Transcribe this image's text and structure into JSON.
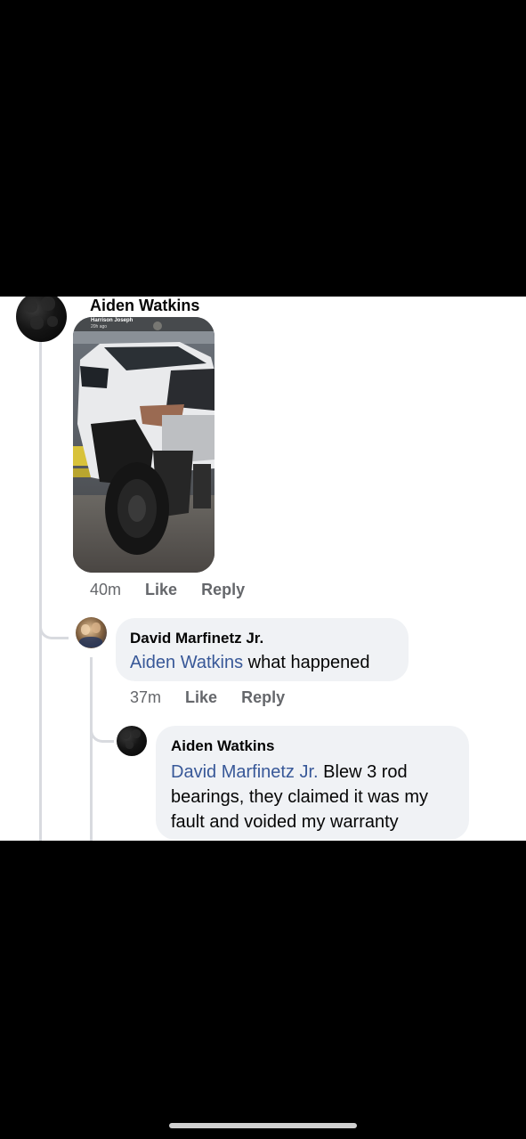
{
  "comment": {
    "author": "Aiden Watkins",
    "photo_overlay": {
      "name": "Harrison Joseph",
      "time": "20h ago"
    },
    "time": "40m",
    "like_label": "Like",
    "reply_label": "Reply"
  },
  "reply1": {
    "author": "David Marfinetz Jr.",
    "mention": "Aiden Watkins",
    "text": " what happened",
    "time": "37m",
    "like_label": "Like",
    "reply_label": "Reply"
  },
  "reply2": {
    "author": "Aiden Watkins",
    "mention": "David Marfinetz Jr.",
    "text": " Blew 3 rod bearings, they claimed it was my fault and voided my warranty"
  },
  "colors": {
    "link": "#385898",
    "bubble": "#f0f2f5",
    "meta": "#65676b"
  }
}
